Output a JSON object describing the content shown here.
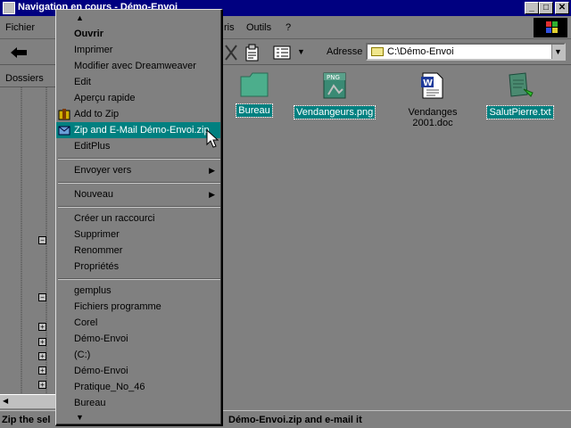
{
  "window": {
    "title": "Navigation en cours - Démo-Envoi",
    "min": "_",
    "max": "□",
    "close": "✕"
  },
  "menubar": {
    "fichier": "Fichier",
    "favoris": "ris",
    "outils": "Outils",
    "aide": "?"
  },
  "toolbar": {
    "address_label": "Adresse",
    "address_value": "C:\\Démo-Envoi"
  },
  "left_panel": {
    "header": "Dossiers"
  },
  "files": [
    {
      "name": "Bureau",
      "selected": true,
      "icon": "folder-icon"
    },
    {
      "name": "Vendangeurs.png",
      "selected": true,
      "icon": "png-icon"
    },
    {
      "name": "Vendanges 2001.doc",
      "selected": false,
      "icon": "word-doc-icon"
    },
    {
      "name": "SalutPierre.txt",
      "selected": true,
      "icon": "txt-icon"
    }
  ],
  "context_menu": {
    "items": [
      {
        "label": "Ouvrir",
        "bold": true
      },
      {
        "label": "Imprimer"
      },
      {
        "label": "Modifier avec Dreamweaver"
      },
      {
        "label": "Edit"
      },
      {
        "label": "Aperçu rapide"
      },
      {
        "label": "Add to Zip"
      },
      {
        "label": "Zip and E-Mail Démo-Envoi.zip",
        "highlighted": true
      },
      {
        "label": "EditPlus"
      },
      {
        "label": "Envoyer vers",
        "submenu": true
      },
      {
        "label": "Nouveau",
        "submenu": true
      },
      {
        "label": "Créer un raccourci"
      },
      {
        "label": "Supprimer"
      },
      {
        "label": "Renommer"
      },
      {
        "label": "Propriétés"
      },
      {
        "label": "gemplus"
      },
      {
        "label": "Fichiers programme"
      },
      {
        "label": "Corel"
      },
      {
        "label": "Démo-Envoi"
      },
      {
        "label": " (C:)"
      },
      {
        "label": "Démo-Envoi"
      },
      {
        "label": "Pratique_No_46"
      },
      {
        "label": "Bureau"
      }
    ],
    "scroll_up": "▲",
    "scroll_down": "▼",
    "submenu_arrow": "▶"
  },
  "statusbar": {
    "left": "Zip the sel",
    "right": "Démo-Envoi.zip and e-mail it"
  },
  "colors": {
    "titlebar": "#000080",
    "highlight": "#008080",
    "surface": "#808080"
  }
}
